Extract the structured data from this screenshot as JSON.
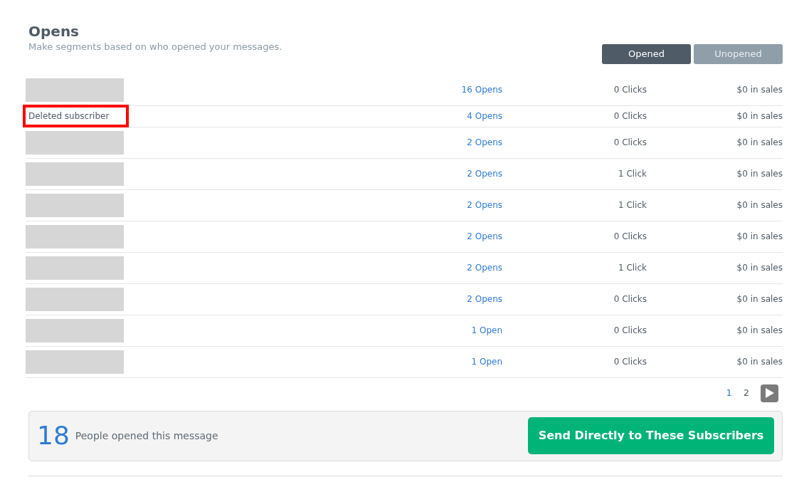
{
  "header": {
    "title": "Opens",
    "subtitle": "Make segments based on who opened your messages."
  },
  "tabs": [
    {
      "label": "Opened",
      "selected": true
    },
    {
      "label": "Unopened",
      "selected": false
    }
  ],
  "rows": [
    {
      "kind": "redacted",
      "opens": "16 Opens",
      "clicks": "0 Clicks",
      "sales": "$0 in sales"
    },
    {
      "kind": "text",
      "name": "Deleted subscriber",
      "highlighted": true,
      "opens": "4 Opens",
      "clicks": "0 Clicks",
      "sales": "$0 in sales"
    },
    {
      "kind": "redacted",
      "opens": "2 Opens",
      "clicks": "0 Clicks",
      "sales": "$0 in sales"
    },
    {
      "kind": "redacted",
      "opens": "2 Opens",
      "clicks": "1 Click",
      "sales": "$0 in sales"
    },
    {
      "kind": "redacted",
      "opens": "2 Opens",
      "clicks": "1 Click",
      "sales": "$0 in sales"
    },
    {
      "kind": "redacted",
      "opens": "2 Opens",
      "clicks": "0 Clicks",
      "sales": "$0 in sales"
    },
    {
      "kind": "redacted",
      "opens": "2 Opens",
      "clicks": "1 Click",
      "sales": "$0 in sales"
    },
    {
      "kind": "redacted",
      "opens": "2 Opens",
      "clicks": "0 Clicks",
      "sales": "$0 in sales"
    },
    {
      "kind": "redacted",
      "opens": "1 Open",
      "clicks": "0 Clicks",
      "sales": "$0 in sales"
    },
    {
      "kind": "redacted",
      "opens": "1 Open",
      "clicks": "0 Clicks",
      "sales": "$0 in sales"
    }
  ],
  "pagination": {
    "pages": [
      {
        "label": "1",
        "selected": true
      },
      {
        "label": "2",
        "selected": false
      }
    ]
  },
  "summary": {
    "count": "18",
    "text": "People opened this message",
    "button": "Send Directly to These Subscribers"
  }
}
